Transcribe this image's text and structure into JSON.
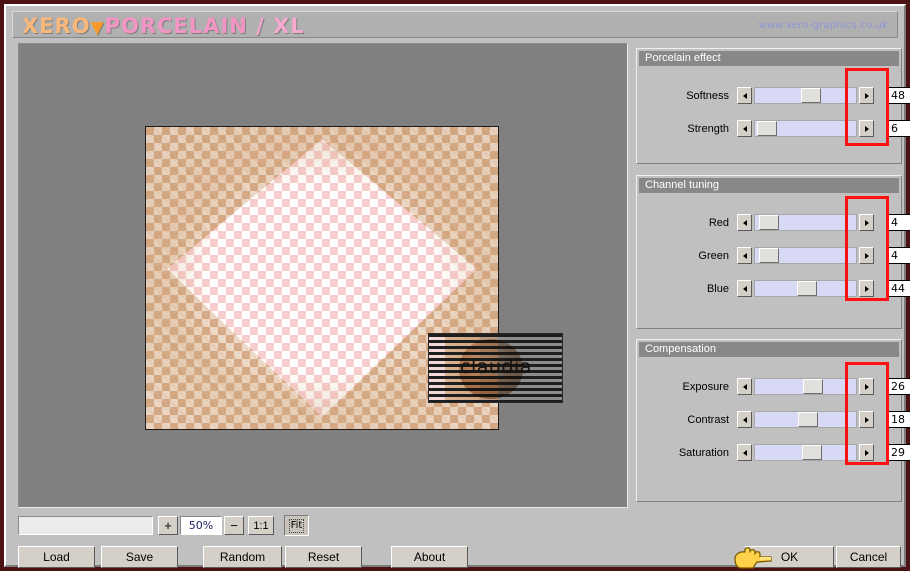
{
  "window": {
    "frame_color": "#4a1212",
    "face_color": "#c0c0c0"
  },
  "banner": {
    "brand_part1": "XERO",
    "brand_marker": "▼",
    "brand_part2": "PORCELAIN",
    "brand_part3": " / XL",
    "url": "www.xero-graphics.co.uk",
    "brand_color_1": "#f9b87a",
    "brand_color_2": "#f79a2a",
    "brand_color_3": "#f294c4",
    "url_color": "#8f96d8"
  },
  "preview": {
    "watermark_text": "claudia",
    "background": "checkerboard-transparency"
  },
  "zoom_toolbar": {
    "status_value": "",
    "status_placeholder": "",
    "plus_label": "+",
    "zoom_level": "50%",
    "minus_label": "−",
    "actual_size_label": "1:1",
    "fit_label": "Fit"
  },
  "buttons": {
    "load": "Load",
    "save": "Save",
    "random": "Random",
    "reset": "Reset",
    "about": "About",
    "ok": "OK",
    "cancel": "Cancel"
  },
  "panels": [
    {
      "title": "Porcelain effect",
      "rows": [
        {
          "label": "Softness",
          "value": "48",
          "thumb_pct": 46
        },
        {
          "label": "Strength",
          "value": "6",
          "thumb_pct": 6
        }
      ]
    },
    {
      "title": "Channel tuning",
      "rows": [
        {
          "label": "Red",
          "value": "4",
          "thumb_pct": 6
        },
        {
          "label": "Green",
          "value": "4",
          "thumb_pct": 6
        },
        {
          "label": "Blue",
          "value": "44",
          "thumb_pct": 42
        }
      ]
    },
    {
      "title": "Compensation",
      "rows": [
        {
          "label": "Exposure",
          "value": "26",
          "thumb_pct": 48
        },
        {
          "label": "Contrast",
          "value": "18",
          "thumb_pct": 44
        },
        {
          "label": "Saturation",
          "value": "29",
          "thumb_pct": 47
        }
      ]
    }
  ],
  "annotations": {
    "color": "#ff1111",
    "count": 3
  },
  "cursor": {
    "type": "pointing-hand",
    "color": "#ffd24a",
    "points_at": "OK"
  }
}
